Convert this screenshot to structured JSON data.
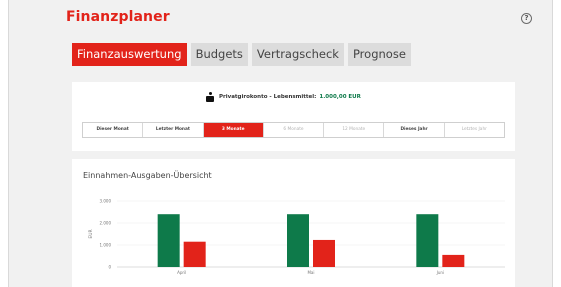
{
  "app": {
    "title": "Finanzplaner",
    "help_icon": "help-circle-icon",
    "help_label": "?"
  },
  "tabs": [
    {
      "label": "Finanzauswertung",
      "active": true
    },
    {
      "label": "Budgets",
      "active": false
    },
    {
      "label": "Vertragscheck",
      "active": false
    },
    {
      "label": "Prognose",
      "active": false
    }
  ],
  "account": {
    "icon": "sparkasse-logo-icon",
    "label": "Privatgirokonto - Lebensmittel:",
    "amount": "1.000,00 EUR"
  },
  "periods": [
    {
      "label": "Dieser Monat",
      "state": "normal"
    },
    {
      "label": "Letzter Monat",
      "state": "normal"
    },
    {
      "label": "3 Monate",
      "state": "active"
    },
    {
      "label": "6 Monate",
      "state": "muted"
    },
    {
      "label": "12 Monate",
      "state": "muted"
    },
    {
      "label": "Dieses Jahr",
      "state": "normal"
    },
    {
      "label": "Letztes Jahr",
      "state": "muted"
    }
  ],
  "colors": {
    "accent": "#e2231a",
    "income": "#0e7a4a",
    "expense": "#e2231a"
  },
  "chart": {
    "title": "Einnahmen-Ausgaben-Übersicht"
  },
  "chart_data": {
    "type": "bar",
    "categories": [
      "April",
      "Mai",
      "Juni"
    ],
    "series": [
      {
        "values": [
          2400,
          2400,
          2400
        ],
        "color": "#0e7a4a"
      },
      {
        "values": [
          1150,
          1230,
          550
        ],
        "color": "#e2231a"
      }
    ],
    "ylabel": "EUR",
    "yticks": [
      "0",
      "1.000",
      "2.000",
      "3.000"
    ],
    "ylim": [
      0,
      3000
    ],
    "grid": true
  }
}
